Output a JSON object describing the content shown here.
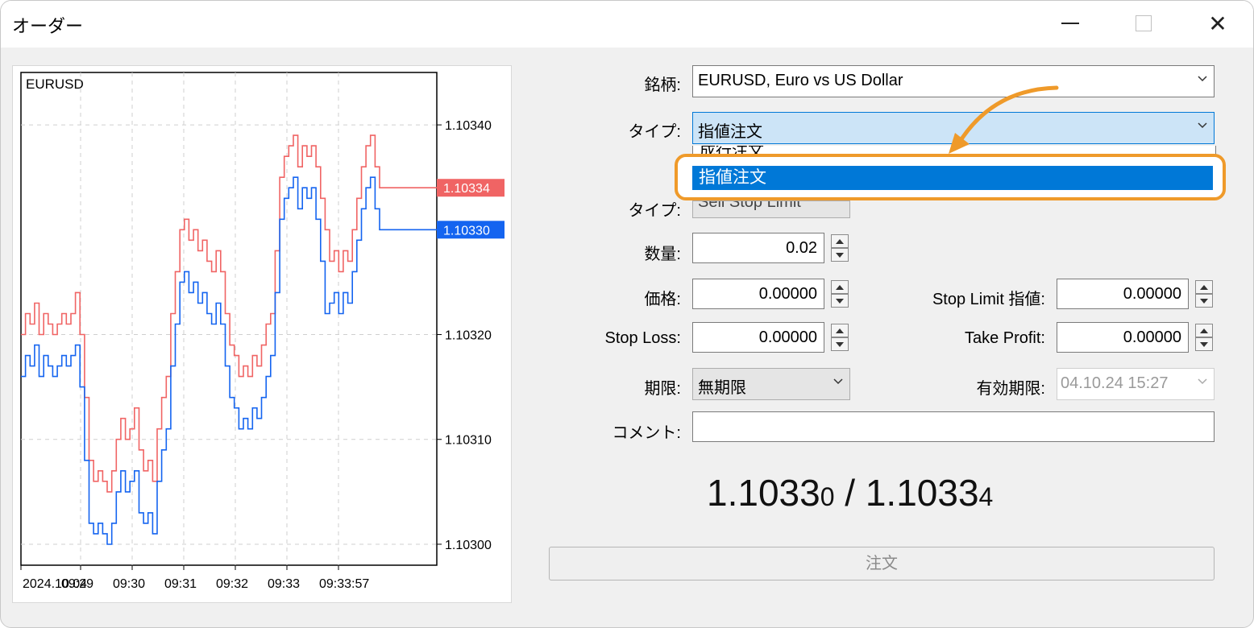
{
  "window": {
    "title": "オーダー"
  },
  "chart_data": {
    "type": "line",
    "title": "EURUSD",
    "x_ticks": [
      "2024.10.04",
      "09:29",
      "09:30",
      "09:31",
      "09:32",
      "09:33",
      "09:33:57"
    ],
    "y_ticks": [
      "1.10340",
      "1.10320",
      "1.10310",
      "1.10300"
    ],
    "ylim": [
      1.10298,
      1.10345
    ],
    "grid": true,
    "series": [
      {
        "color": "#f06464",
        "last_value_label": "1.10334",
        "last_value": 1.10334,
        "values": [
          1.1032,
          1.10322,
          1.10321,
          1.10323,
          1.1032,
          1.10322,
          1.10321,
          1.1032,
          1.10321,
          1.10322,
          1.10321,
          1.10322,
          1.10324,
          1.1032,
          1.10314,
          1.10308,
          1.10306,
          1.10307,
          1.10306,
          1.10305,
          1.10307,
          1.1031,
          1.10312,
          1.1031,
          1.10311,
          1.10313,
          1.10309,
          1.10307,
          1.10308,
          1.10306,
          1.10311,
          1.10314,
          1.10316,
          1.10322,
          1.10326,
          1.1033,
          1.10331,
          1.10329,
          1.1033,
          1.10328,
          1.10329,
          1.10327,
          1.10326,
          1.10328,
          1.10326,
          1.10322,
          1.10319,
          1.10318,
          1.10316,
          1.10317,
          1.10316,
          1.10318,
          1.10317,
          1.10319,
          1.10321,
          1.10322,
          1.10328,
          1.10335,
          1.10337,
          1.10338,
          1.10339,
          1.10336,
          1.10338,
          1.10337,
          1.10338,
          1.10336,
          1.10333,
          1.1033,
          1.10327,
          1.10328,
          1.10326,
          1.10328,
          1.10327,
          1.1033,
          1.10333,
          1.10336,
          1.10338,
          1.10339,
          1.10336,
          1.10334,
          1.10334,
          1.10334,
          1.10334,
          1.10334,
          1.10334
        ]
      },
      {
        "color": "#1464f0",
        "last_value_label": "1.10330",
        "last_value": 1.1033,
        "values": [
          1.10316,
          1.10318,
          1.10317,
          1.10319,
          1.10316,
          1.10318,
          1.10317,
          1.10316,
          1.10317,
          1.10318,
          1.10317,
          1.10318,
          1.10319,
          1.10315,
          1.10308,
          1.10302,
          1.10301,
          1.10302,
          1.10301,
          1.103,
          1.10302,
          1.10305,
          1.10307,
          1.10305,
          1.10306,
          1.10307,
          1.10303,
          1.10302,
          1.10303,
          1.10301,
          1.10306,
          1.10309,
          1.10311,
          1.10317,
          1.10321,
          1.10325,
          1.10326,
          1.10324,
          1.10325,
          1.10323,
          1.10324,
          1.10322,
          1.10321,
          1.10323,
          1.10321,
          1.10317,
          1.10314,
          1.10313,
          1.10311,
          1.10312,
          1.10311,
          1.10313,
          1.10312,
          1.10314,
          1.10316,
          1.10318,
          1.10324,
          1.10331,
          1.10333,
          1.10334,
          1.10335,
          1.10332,
          1.10334,
          1.10333,
          1.10334,
          1.10331,
          1.10327,
          1.10322,
          1.10323,
          1.10324,
          1.10322,
          1.10324,
          1.10323,
          1.10326,
          1.10329,
          1.10332,
          1.10334,
          1.10335,
          1.10332,
          1.1033,
          1.1033,
          1.1033,
          1.1033,
          1.1033,
          1.1033
        ]
      }
    ]
  },
  "form": {
    "symbol_label": "銘柄:",
    "symbol_value": "EURUSD, Euro vs US Dollar",
    "type_label": "タイプ:",
    "type_value": "指値注文",
    "type_dropdown_prev": "成行注文",
    "type_dropdown_selected": "指値注文",
    "type2_label": "タイプ:",
    "type2_value": "Sell Stop Limit",
    "volume_label": "数量:",
    "volume_value": "0.02",
    "price_label": "価格:",
    "price_value": "0.00000",
    "stop_limit_label": "Stop Limit 指値:",
    "stop_limit_value": "0.00000",
    "stop_loss_label": "Stop Loss:",
    "stop_loss_value": "0.00000",
    "take_profit_label": "Take Profit:",
    "take_profit_value": "0.00000",
    "expiry_label": "期限:",
    "expiry_value": "無期限",
    "expiry_date_label": "有効期限:",
    "expiry_date_value": "04.10.24 15:27",
    "comment_label": "コメント:",
    "comment_value": ""
  },
  "quote": {
    "bid_main": "1.1033",
    "bid_small": "0",
    "sep": " / ",
    "ask_main": "1.1033",
    "ask_small": "4"
  },
  "order_button": {
    "label": "注文"
  },
  "colors": {
    "highlight": "#ef9a2a",
    "selection": "#0078d7"
  }
}
